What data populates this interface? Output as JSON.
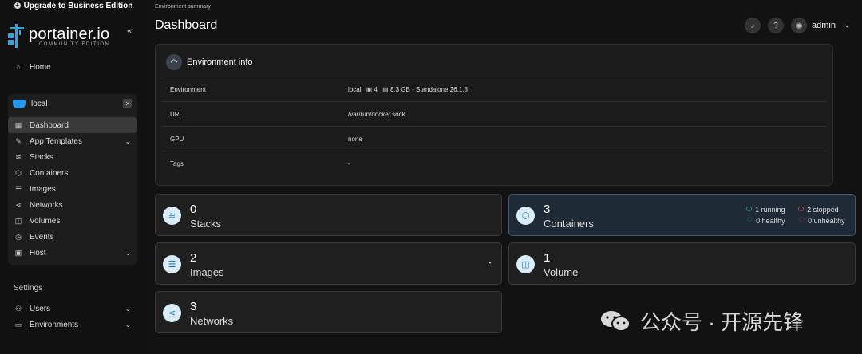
{
  "upgrade_banner": "Upgrade to Business Edition",
  "brand": {
    "name": "portainer.io",
    "edition": "COMMUNITY EDITION"
  },
  "sidebar": {
    "home": "Home",
    "environment": {
      "name": "local"
    },
    "env_items": [
      {
        "label": "Dashboard",
        "icon": "dashboard-icon",
        "active": true
      },
      {
        "label": "App Templates",
        "icon": "edit-icon",
        "expandable": true
      },
      {
        "label": "Stacks",
        "icon": "layers-icon"
      },
      {
        "label": "Containers",
        "icon": "cube-icon"
      },
      {
        "label": "Images",
        "icon": "list-icon"
      },
      {
        "label": "Networks",
        "icon": "share-icon"
      },
      {
        "label": "Volumes",
        "icon": "database-icon"
      },
      {
        "label": "Events",
        "icon": "history-icon"
      },
      {
        "label": "Host",
        "icon": "server-icon",
        "expandable": true
      }
    ],
    "settings_label": "Settings",
    "settings_items": [
      {
        "label": "Users",
        "icon": "users-icon",
        "expandable": true
      },
      {
        "label": "Environments",
        "icon": "hdd-icon",
        "expandable": true
      }
    ]
  },
  "header": {
    "breadcrumb": "Environment summary",
    "title": "Dashboard",
    "user": "admin"
  },
  "env_info": {
    "title": "Environment info",
    "rows": [
      {
        "key": "Environment",
        "value": "local",
        "cpu": "4",
        "memory": "8.3 GB",
        "detail": "- Standalone 26.1.3"
      },
      {
        "key": "URL",
        "value": "/var/run/docker.sock"
      },
      {
        "key": "GPU",
        "value": "none"
      },
      {
        "key": "Tags",
        "value": "-"
      }
    ]
  },
  "stats": {
    "stacks": {
      "count": "0",
      "label": "Stacks"
    },
    "containers": {
      "count": "3",
      "label": "Containers",
      "running": "1 running",
      "stopped": "2 stopped",
      "healthy": "0 healthy",
      "unhealthy": "0 unhealthy"
    },
    "images": {
      "count": "2",
      "label": "Images"
    },
    "volumes": {
      "count": "1",
      "label": "Volume"
    },
    "networks": {
      "count": "3",
      "label": "Networks"
    }
  },
  "watermark": "公众号 · 开源先锋",
  "colors": {
    "accent": "#3aa0d8",
    "running": "#3cb371",
    "stopped": "#d9534f"
  }
}
